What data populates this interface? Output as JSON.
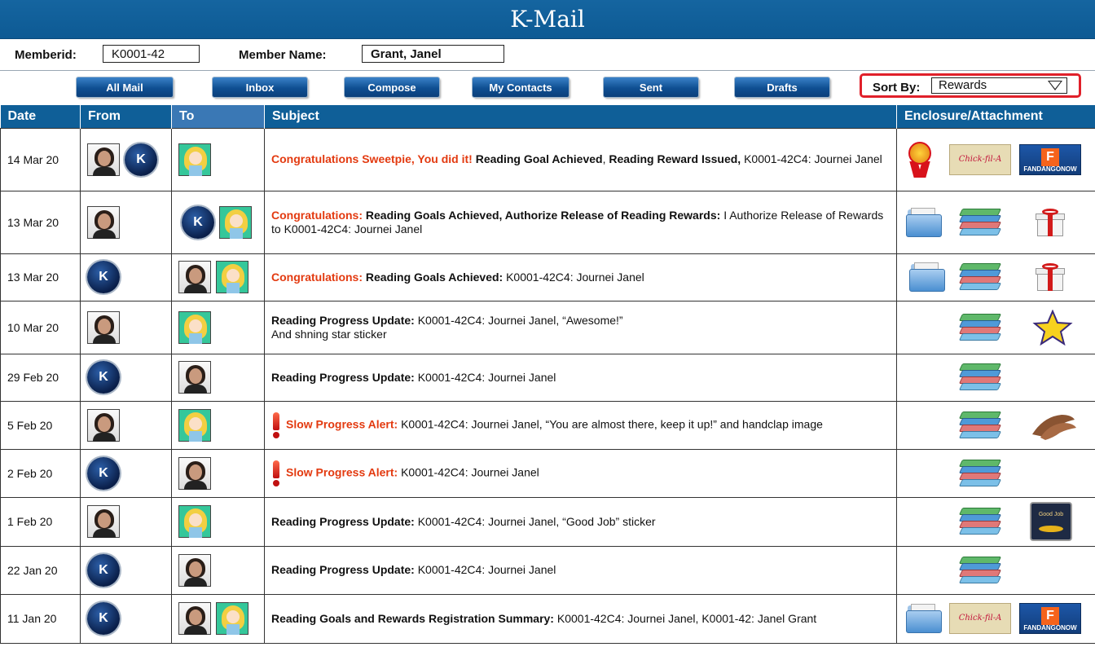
{
  "app": {
    "title": "K-Mail"
  },
  "member": {
    "id_label": "Memberid:",
    "id_value": "K0001-42",
    "name_label": "Member Name:",
    "name_value": "Grant, Janel"
  },
  "toolbar": {
    "buttons": [
      "All Mail",
      "Inbox",
      "Compose",
      "My Contacts",
      "Sent",
      "Drafts"
    ],
    "sort_label": "Sort By:",
    "sort_value": "Rewards"
  },
  "table": {
    "headers": [
      "Date",
      "From",
      "To",
      "Subject",
      "Enclosure/Attachment"
    ],
    "rows": [
      {
        "date": "14 Mar 20",
        "from": [
          "teacher-avatar",
          "k-avatar"
        ],
        "to": [
          "student-avatar"
        ],
        "subject": [
          {
            "t": "Congratulations Sweetpie, You did it! ",
            "s": "red"
          },
          {
            "t": "Reading Goal Achieved",
            "s": "b"
          },
          {
            "t": ", ",
            "s": ""
          },
          {
            "t": "Reading Reward Issued,",
            "s": "b"
          },
          {
            "t": " K0001-42C4: Journei Janel",
            "s": ""
          }
        ],
        "encl": [
          "medal-icon",
          "chickfila-gift-card",
          "fandango-gift-card"
        ]
      },
      {
        "date": "13 Mar 20",
        "from": [
          "teacher-avatar"
        ],
        "to": [
          "k-avatar",
          "student-avatar"
        ],
        "subject": [
          {
            "t": "Congratulations: ",
            "s": "red"
          },
          {
            "t": " Reading Goals Achieved, Authorize Release of Reading Rewards: ",
            "s": "b"
          },
          {
            "t": " I Authorize Release of Rewards to K0001-42C4: Journei Janel",
            "s": ""
          }
        ],
        "encl": [
          "folder-icon",
          "books-icon",
          "gift-icon"
        ]
      },
      {
        "date": "13 Mar 20",
        "from": [
          "k-avatar"
        ],
        "to": [
          "teacher-avatar",
          "student-avatar"
        ],
        "subject": [
          {
            "t": "Congratulations: ",
            "s": "red"
          },
          {
            "t": "Reading Goals Achieved: ",
            "s": "b"
          },
          {
            "t": " K0001-42C4: Journei Janel",
            "s": ""
          }
        ],
        "encl": [
          "folder-icon",
          "books-icon",
          "gift-icon"
        ]
      },
      {
        "date": "10 Mar 20",
        "from": [
          "teacher-avatar"
        ],
        "to": [
          "student-avatar"
        ],
        "subject": [
          {
            "t": "Reading Progress Update: ",
            "s": "b"
          },
          {
            "t": " K0001-42C4:  Journei Janel, “Awesome!”",
            "s": ""
          },
          {
            "t": "And shning star sticker",
            "s": "br"
          }
        ],
        "encl": [
          "books-icon",
          "star-sticker-icon"
        ]
      },
      {
        "date": "29 Feb 20",
        "from": [
          "k-avatar"
        ],
        "to": [
          "teacher-avatar"
        ],
        "subject": [
          {
            "t": "Reading Progress Update: ",
            "s": "b"
          },
          {
            "t": " K0001-42C4:  Journei Janel",
            "s": ""
          }
        ],
        "encl": [
          "books-icon"
        ]
      },
      {
        "date": "5 Feb 20",
        "from": [
          "teacher-avatar"
        ],
        "to": [
          "student-avatar"
        ],
        "alert": true,
        "subject": [
          {
            "t": "Slow Progress Alert: ",
            "s": "red"
          },
          {
            "t": " K0001-42C4: Journei Janel, “You are almost there, keep it up!” and handclap image",
            "s": ""
          }
        ],
        "encl": [
          "books-icon",
          "handclap-icon"
        ]
      },
      {
        "date": "2 Feb 20",
        "from": [
          "k-avatar"
        ],
        "to": [
          "teacher-avatar"
        ],
        "alert": true,
        "subject": [
          {
            "t": "Slow Progress Alert: ",
            "s": "red"
          },
          {
            "t": " K0001-42C4: Journei Janel",
            "s": ""
          }
        ],
        "encl": [
          "books-icon"
        ]
      },
      {
        "date": "1 Feb 20",
        "from": [
          "teacher-avatar"
        ],
        "to": [
          "student-avatar"
        ],
        "subject": [
          {
            "t": "Reading Progress Update: ",
            "s": "b"
          },
          {
            "t": " K0001-42C4:  Journei Janel, “Good Job” sticker",
            "s": ""
          }
        ],
        "encl": [
          "books-icon",
          "good-job-sticker-icon"
        ]
      },
      {
        "date": "22 Jan 20",
        "from": [
          "k-avatar"
        ],
        "to": [
          "teacher-avatar"
        ],
        "subject": [
          {
            "t": "Reading Progress Update: ",
            "s": "b"
          },
          {
            "t": "K0001-42C4: Journei Janel",
            "s": ""
          }
        ],
        "encl": [
          "books-icon"
        ]
      },
      {
        "date": "11 Jan 20",
        "from": [
          "k-avatar"
        ],
        "to": [
          "teacher-avatar",
          "student-avatar"
        ],
        "subject": [
          {
            "t": "Reading Goals and Rewards Registration Summary: ",
            "s": "b"
          },
          {
            "t": " K0001-42C4:  Journei Janel, K0001-42: Janel Grant",
            "s": ""
          }
        ],
        "encl": [
          "folder-icon",
          "chickfila-gift-card",
          "fandango-gift-card"
        ]
      }
    ]
  },
  "images": {
    "chickfila": "Chick-fil-A",
    "fandango": "F",
    "fandango_sub": "FANDANGONOW",
    "goodjob": "Good Job",
    "k_letter": "K"
  },
  "colors": {
    "header": "#0f5f98",
    "accent_red": "#e33a10",
    "sort_outline": "#e0202a"
  }
}
